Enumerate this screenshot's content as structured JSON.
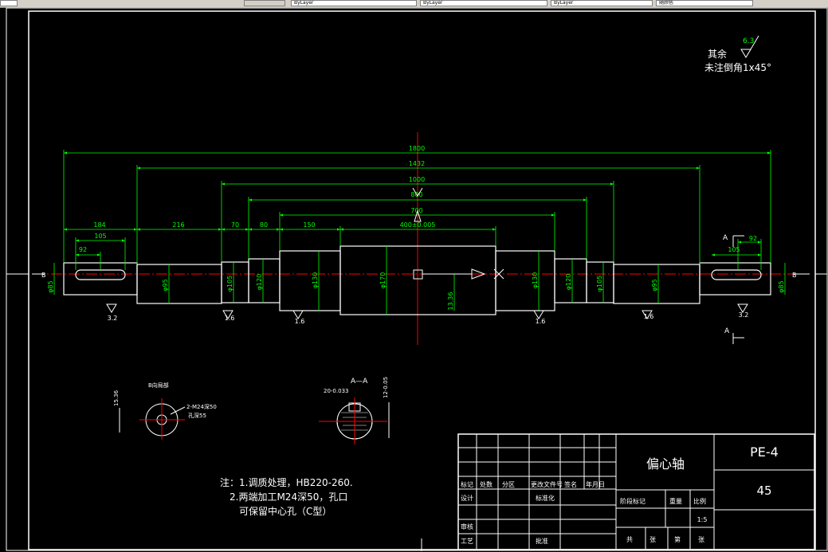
{
  "toolbar": {
    "tabs": [
      "ByLayer",
      "ByLayer",
      "ByLayer",
      "随颜色"
    ]
  },
  "top_note": {
    "roughness": "6.3",
    "remaining_label": "其余",
    "chamfer_note": "未注倒角1x45°"
  },
  "dimensions": {
    "overall": "1800",
    "d1432": "1432",
    "d1000": "1000",
    "d800": "800",
    "d700": "700",
    "d184": "184",
    "d216": "216",
    "d70": "70",
    "d80": "80",
    "d150": "150",
    "d400": "400±0.005",
    "d105_left": "105",
    "d92_left": "92",
    "d105_right": "105",
    "d92_right": "92",
    "diam_85_end_left": "φ85",
    "diam_95_left": "φ95",
    "diam_105_left": "φ105",
    "diam_120_left": "φ120",
    "diam_130_left": "φ130",
    "diam_170": "φ170",
    "diam_130_right": "φ130",
    "diam_120_right": "φ120",
    "diam_105_right": "φ105",
    "diam_95_right": "φ95",
    "diam_85_end_right": "φ85",
    "offset": "13.36",
    "rough_3_2_left": "3.2",
    "rough_1_6_a": "1.6",
    "rough_1_6_b": "1.6",
    "rough_1_6_c": "1.6",
    "rough_1_6_d": "1.6",
    "rough_3_2_right": "3.2",
    "section_b_left": "B",
    "section_b_right": "B",
    "section_a_top": "A",
    "section_a_bottom": "A"
  },
  "detail_b": {
    "title": "B向局部",
    "dim_vertical": "15.36",
    "hole_note": "2-M24深50",
    "hole_note2": "孔深55"
  },
  "detail_a": {
    "title": "A—A",
    "keyway_width": "20-0.033",
    "depth": "12-0.05"
  },
  "notes": {
    "line1": "注：1.调质处理，HB220-260.",
    "line2": "2.两端加工M24深50，孔口",
    "line3": "可保留中心孔（C型）"
  },
  "title_block": {
    "part_name": "偏心轴",
    "drawing_no": "PE-4",
    "material": "45",
    "scale": "1:5",
    "header_row": [
      "标记",
      "处数",
      "分区",
      "更改文件号",
      "签名",
      "年月日"
    ],
    "design_row": [
      "设计",
      "标准化"
    ],
    "review": "审核",
    "process": "工艺",
    "approve": "批准",
    "stage_labels": [
      "阶段标记",
      "重量",
      "比例"
    ],
    "sheet_labels": [
      "共",
      "张",
      "第",
      "张"
    ]
  }
}
